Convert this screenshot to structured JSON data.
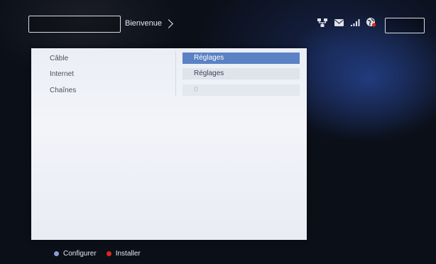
{
  "topbar": {
    "breadcrumb": "Bienvenue",
    "icons": [
      "network-icon",
      "mail-icon",
      "signal-bars-icon",
      "globe-icon"
    ]
  },
  "settings": {
    "rows": [
      {
        "label": "Câble",
        "value": "Réglages"
      },
      {
        "label": "Internet",
        "value": "Réglages"
      },
      {
        "label": "Chaînes",
        "value": "0"
      }
    ]
  },
  "footer": {
    "hints": [
      {
        "label": "Configurer",
        "color": "#8a9dd6"
      },
      {
        "label": "Installer",
        "color": "#e0261f"
      }
    ]
  },
  "colors": {
    "selected_row": "#5a82c4",
    "panel_bg": "#eef1f7"
  }
}
